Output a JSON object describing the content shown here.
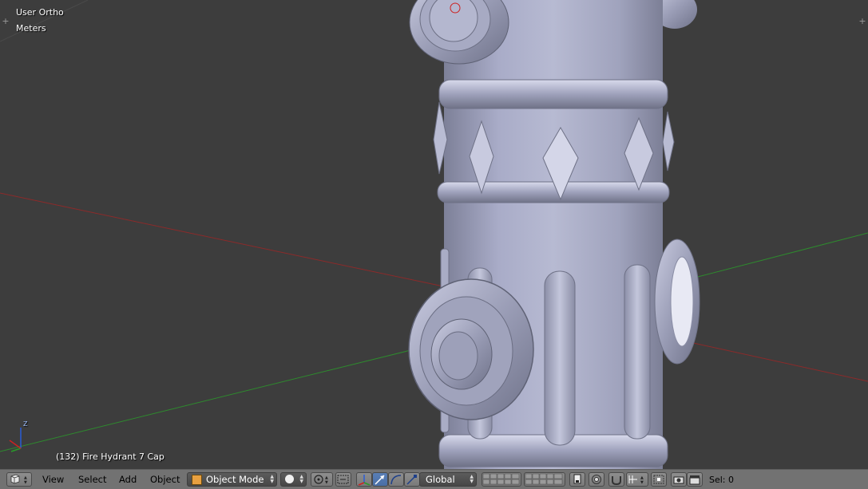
{
  "viewport": {
    "view_name": "User Ortho",
    "units": "Meters",
    "object_info": "(132) Fire Hydrant 7 Cap",
    "axis_label_z": "Z",
    "colors": {
      "background": "#3d3d3d",
      "x_axis": "#8c2a2a",
      "y_axis": "#2e8a2e",
      "hydrant_body": "#a8abc6"
    }
  },
  "header": {
    "editor_icon": "3d-view-icon",
    "menus": [
      "View",
      "Select",
      "Add",
      "Object"
    ],
    "mode": "Object Mode",
    "orientation": "Global",
    "status": "Sel: 0"
  }
}
